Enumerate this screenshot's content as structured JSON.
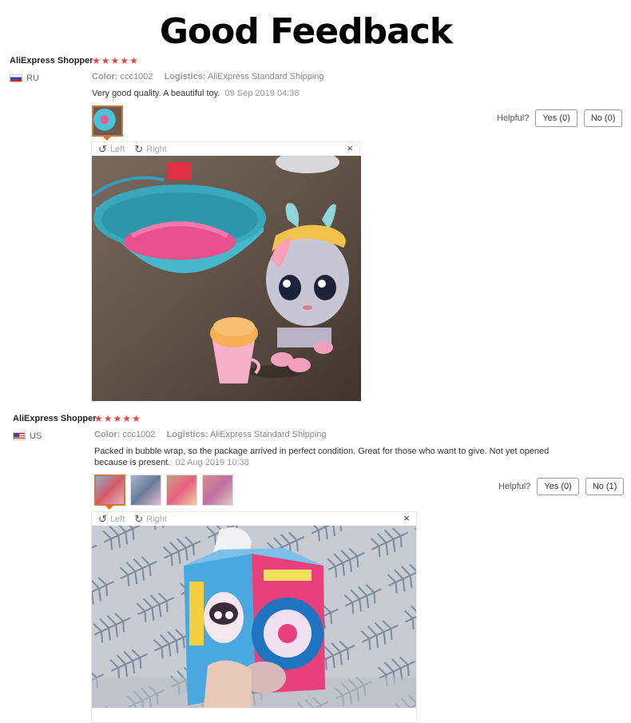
{
  "page_title": "Good Feedback",
  "reviews": [
    {
      "user": "AliExpress Shopper",
      "rating": 5,
      "country": "RU",
      "color_label": "Color:",
      "color_value": "ccc1002",
      "logistics_label": "Logistics:",
      "logistics_value": "AliExpress Standard Shipping",
      "text": "Very good quality. A beautiful toy.",
      "date": "09 Sep 2019 04:38",
      "helpful_label": "Helpful?",
      "yes_label": "Yes (0)",
      "no_label": "No (0)",
      "viewer": {
        "left_label": "Left",
        "right_label": "Right",
        "close_label": "×"
      }
    },
    {
      "user": "AliExpress Shopper",
      "rating": 5,
      "country": "US",
      "color_label": "Color:",
      "color_value": "ccc1002",
      "logistics_label": "Logistics:",
      "logistics_value": "AliExpress Standard Shipping",
      "text": "Packed in bubble wrap, so the package arrived in perfect condition. Great for those who want to give. Not yet opened because is present.",
      "date": "02 Aug 2019 10:38",
      "helpful_label": "Helpful?",
      "yes_label": "Yes (0)",
      "no_label": "No (1)",
      "viewer": {
        "left_label": "Left",
        "right_label": "Right",
        "close_label": "×"
      }
    }
  ],
  "icons": {
    "star": "star-icon",
    "rotate_left": "rotate-left-icon",
    "rotate_right": "rotate-right-icon",
    "close": "close-icon"
  },
  "colors": {
    "star": "#e8453c",
    "thumb_active_border": "#c97a3c",
    "thumb_arrow": "#e07020"
  }
}
